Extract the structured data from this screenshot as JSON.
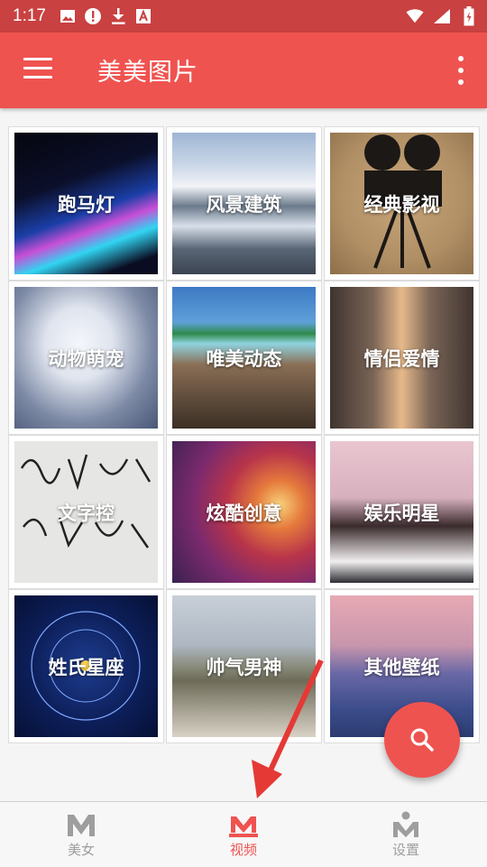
{
  "status_bar": {
    "time": "1:17",
    "icons": [
      "image-icon",
      "alert-icon",
      "download-icon",
      "font-icon"
    ],
    "right_icons": [
      "wifi-icon",
      "signal-icon",
      "battery-icon"
    ]
  },
  "app_bar": {
    "title": "美美图片",
    "color": "#ef5350"
  },
  "categories": [
    {
      "label": "跑马灯"
    },
    {
      "label": "风景建筑"
    },
    {
      "label": "经典影视"
    },
    {
      "label": "动物萌宠"
    },
    {
      "label": "唯美动态"
    },
    {
      "label": "情侣爱情"
    },
    {
      "label": "文字控"
    },
    {
      "label": "炫酷创意"
    },
    {
      "label": "娱乐明星"
    },
    {
      "label": "姓氏星座"
    },
    {
      "label": "帅气男神"
    },
    {
      "label": "其他壁纸"
    }
  ],
  "fab": {
    "icon": "search-icon"
  },
  "bottom_nav": {
    "items": [
      {
        "label": "美女",
        "icon": "m-icon",
        "active": false
      },
      {
        "label": "视频",
        "icon": "m-crown-icon",
        "active": true
      },
      {
        "label": "设置",
        "icon": "m-person-icon",
        "active": false
      }
    ]
  }
}
